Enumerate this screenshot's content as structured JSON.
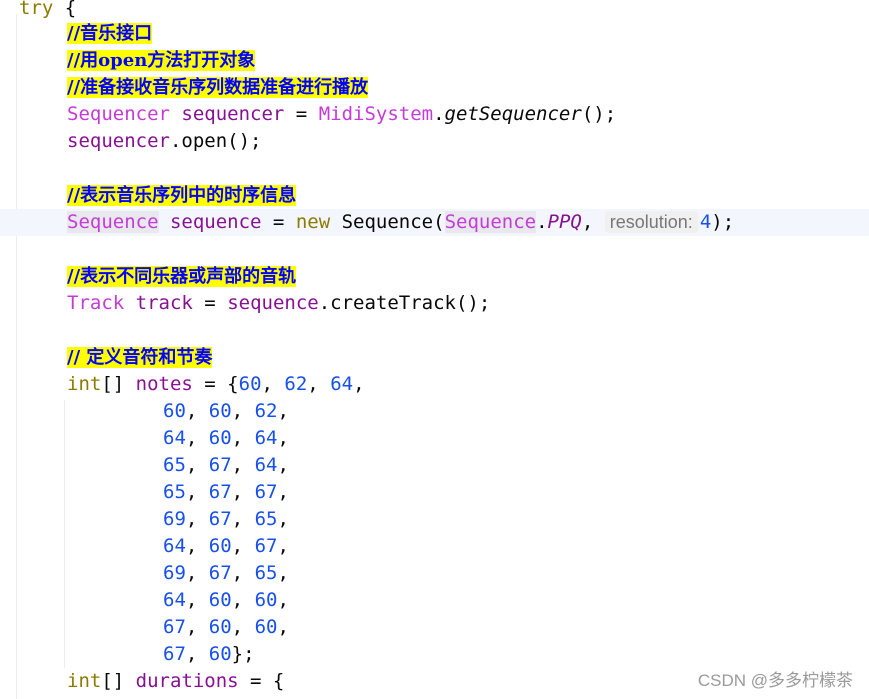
{
  "code": {
    "l0_kw": "try",
    "l0_brace": " {",
    "c1": "//音乐接口",
    "c2": "//用open方法打开对象",
    "c3": "//准备接收音乐序列数据准备进行播放",
    "l4_t1": "Sequencer",
    "l4_v": "sequencer",
    "l4_eq": " = ",
    "l4_t2": "MidiSystem",
    "l4_dot": ".",
    "l4_m": "getSequencer",
    "l4_end": "();",
    "l5_v": "sequencer",
    "l5_rest": ".open();",
    "c6": "//表示音乐序列中的时序信息",
    "l7_t1": "Sequence",
    "l7_v": "sequence",
    "l7_eq": " = ",
    "l7_kw": "new",
    "l7_ctor": "Sequence",
    "l7_paren": "(",
    "l7_t2": "Sequence",
    "l7_dot": ".",
    "l7_f": "PPQ",
    "l7_comma": ", ",
    "l7_hint": "resolution:",
    "l7_n": "4",
    "l7_end": ");",
    "c8": "//表示不同乐器或声部的音轨",
    "l9_t": "Track",
    "l9_v": "track",
    "l9_eq": " = ",
    "l9_obj": "sequence",
    "l9_rest": ".createTrack();",
    "c10": "// 定义音符和节奏",
    "l11_kw": "int",
    "l11_br": "[] ",
    "l11_v": "notes",
    "l11_eq": " = {",
    "l11_n1": "60",
    "l11_n2": "62",
    "l11_n3": "64",
    "notes_rows": [
      [
        "60",
        "60",
        "62"
      ],
      [
        "64",
        "60",
        "64"
      ],
      [
        "65",
        "67",
        "64"
      ],
      [
        "65",
        "67",
        "67"
      ],
      [
        "69",
        "67",
        "65"
      ],
      [
        "64",
        "60",
        "67"
      ],
      [
        "69",
        "67",
        "65"
      ],
      [
        "64",
        "60",
        "60"
      ],
      [
        "67",
        "60",
        "60"
      ]
    ],
    "last_n1": "67",
    "last_n2": "60",
    "last_end": "};",
    "l13_kw": "int",
    "l13_br": "[] ",
    "l13_v": "durations",
    "l13_eq": " = {"
  },
  "watermark": "CSDN @多多柠檬茶"
}
